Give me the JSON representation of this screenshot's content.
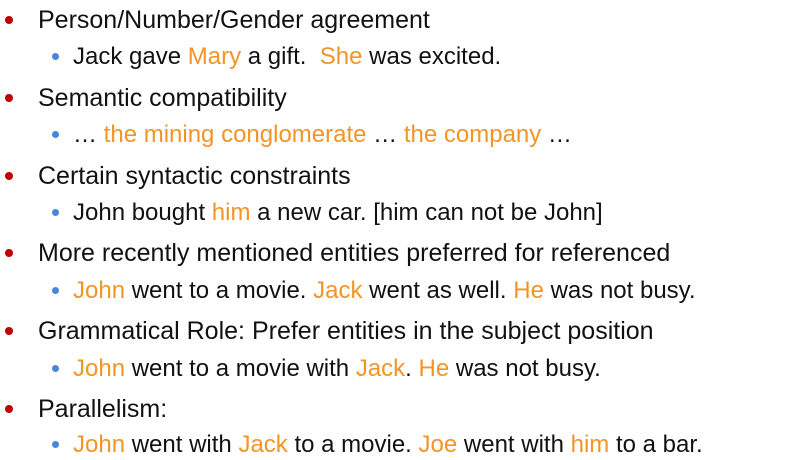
{
  "colors": {
    "bullet_primary": "#c00000",
    "bullet_secondary": "#4a86d8",
    "highlight": "#f29525",
    "text": "#111111"
  },
  "bullets": [
    {
      "heading": "Person/Number/Gender agreement",
      "example": [
        {
          "text": "Jack gave ",
          "hl": false
        },
        {
          "text": "Mary",
          "hl": true
        },
        {
          "text": " a gift.  ",
          "hl": false
        },
        {
          "text": "She",
          "hl": true
        },
        {
          "text": " was excited.",
          "hl": false
        }
      ]
    },
    {
      "heading": "Semantic compatibility",
      "example": [
        {
          "text": "… ",
          "hl": false
        },
        {
          "text": "the mining conglomerate",
          "hl": true
        },
        {
          "text": " … ",
          "hl": false
        },
        {
          "text": "the company",
          "hl": true
        },
        {
          "text": " …",
          "hl": false
        }
      ]
    },
    {
      "heading": "Certain syntactic constraints",
      "example": [
        {
          "text": "John bought ",
          "hl": false
        },
        {
          "text": "him",
          "hl": true
        },
        {
          "text": " a new car. [him can not be John]",
          "hl": false
        }
      ]
    },
    {
      "heading": "More recently mentioned entities preferred for referenced",
      "example": [
        {
          "text": "John",
          "hl": true
        },
        {
          "text": " went to a movie. ",
          "hl": false
        },
        {
          "text": "Jack",
          "hl": true
        },
        {
          "text": " went as well. ",
          "hl": false
        },
        {
          "text": "He",
          "hl": true
        },
        {
          "text": " was not busy.",
          "hl": false
        }
      ]
    },
    {
      "heading": "Grammatical Role: Prefer entities in the subject position",
      "example": [
        {
          "text": "John",
          "hl": true
        },
        {
          "text": " went to a movie with ",
          "hl": false
        },
        {
          "text": "Jack",
          "hl": true
        },
        {
          "text": ". ",
          "hl": false
        },
        {
          "text": "He",
          "hl": true
        },
        {
          "text": " was not busy.",
          "hl": false
        }
      ]
    },
    {
      "heading": "Parallelism:",
      "example": [
        {
          "text": "John",
          "hl": true
        },
        {
          "text": " went with ",
          "hl": false
        },
        {
          "text": "Jack",
          "hl": true
        },
        {
          "text": " to a movie. ",
          "hl": false
        },
        {
          "text": "Joe",
          "hl": true
        },
        {
          "text": " went with ",
          "hl": false
        },
        {
          "text": "him",
          "hl": true
        },
        {
          "text": " to a bar.",
          "hl": false
        }
      ]
    }
  ]
}
